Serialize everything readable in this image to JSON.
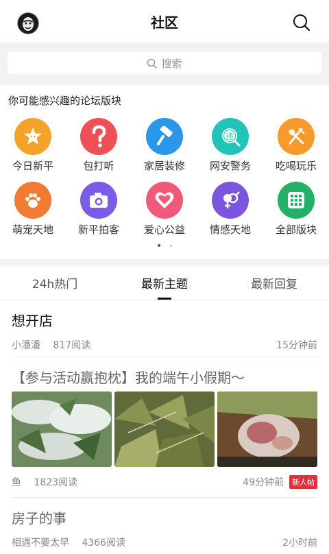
{
  "header": {
    "title": "社区"
  },
  "search": {
    "placeholder": "搜索"
  },
  "section_label": "你可能感兴趣的论坛版块",
  "forums": [
    {
      "label": "今日新平",
      "color": "#f4a32a",
      "icon": "star-face-icon"
    },
    {
      "label": "包打听",
      "color": "#ef4f56",
      "icon": "question-mark-icon"
    },
    {
      "label": "家居装修",
      "color": "#2b97e8",
      "icon": "paint-roller-icon"
    },
    {
      "label": "网安警务",
      "color": "#22c3b8",
      "icon": "police-badge-icon"
    },
    {
      "label": "吃喝玩乐",
      "color": "#f79a2c",
      "icon": "fork-spoon-icon"
    },
    {
      "label": "萌宠天地",
      "color": "#f27b34",
      "icon": "paw-icon"
    },
    {
      "label": "新平拍客",
      "color": "#7a5ce6",
      "icon": "camera-icon"
    },
    {
      "label": "爱心公益",
      "color": "#ef5a7b",
      "icon": "heart-icon"
    },
    {
      "label": "情感天地",
      "color": "#7b55de",
      "icon": "gender-icon"
    },
    {
      "label": "全部版块",
      "color": "#25b06a",
      "icon": "grid-icon"
    }
  ],
  "tabs": [
    "24h热门",
    "最新主题",
    "最新回复"
  ],
  "posts": [
    {
      "title": "想开店",
      "author": "小潘潘",
      "reads": "817阅读",
      "time": "15分钟前"
    },
    {
      "title": "【参与活动赢抱枕】我的端午小假期～",
      "author": "鱼",
      "reads": "1823阅读",
      "time": "49分钟前",
      "badge": "新人帖"
    },
    {
      "title": "房子的事",
      "author": "相遇不要太早",
      "reads": "4366阅读",
      "time": "2小时前"
    }
  ]
}
